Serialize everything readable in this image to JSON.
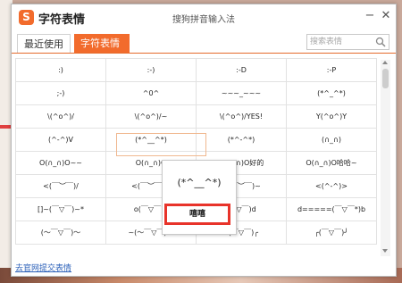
{
  "window": {
    "title": "字符表情",
    "subtitle": "搜狗拼音输入法",
    "logo": "S",
    "minimize_icon": "minimize-icon",
    "close_icon": "close-icon"
  },
  "tabs": [
    {
      "label": "最近使用",
      "active": false
    },
    {
      "label": "字符表情",
      "active": true
    }
  ],
  "search": {
    "placeholder": "搜索表情",
    "value": ""
  },
  "grid": [
    [
      ":)",
      ":-)",
      ":-D",
      ":-P"
    ],
    [
      ";-)",
      "^0^",
      "~~~_~~~",
      "(*^_^*)"
    ],
    [
      "\\(^o^)/",
      "\\(^o^)/~",
      "\\(^o^)/YES!",
      "Y(^o^)Y"
    ],
    [
      "(^-^)V",
      "(*^__^*)",
      "(*^-^*)",
      "(∩_∩)"
    ],
    [
      "O(∩_∩)O~~",
      "O(∩_∩)O",
      "O(∩_∩)O好的",
      "O(∩_∩)O哈哈~"
    ],
    [
      "<(￣︶￣)/",
      "<(￣︶￣)>",
      "<(￣︶￣)~",
      "<(^-^)>"
    ],
    [
      "[]~(￣▽￣)~*",
      "o(￣▽￣)o",
      "(￣▽￣)d",
      "d=====(￣▽￣*)b"
    ],
    [
      "(～￣▽￣)～",
      "~(～￣▽￣)～",
      "╰(￣▽￣)╭",
      "╭(￣▽￣)╯"
    ]
  ],
  "popup": {
    "preview": "(*^__^*)",
    "label": "嘻嘻"
  },
  "footer": {
    "link": "去官网提交表情"
  },
  "colors": {
    "accent": "#f26b2c",
    "highlight": "#e8332a",
    "link": "#2a5fb8"
  }
}
